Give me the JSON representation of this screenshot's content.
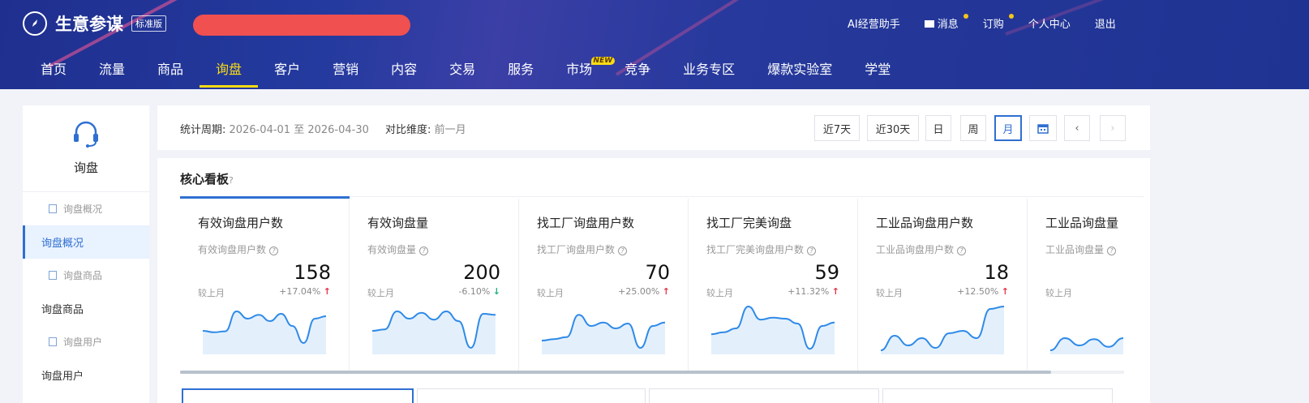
{
  "header": {
    "brand": "生意参谋",
    "edition": "标准版",
    "top_links": [
      "AI经营助手",
      "消息",
      "订购",
      "个人中心",
      "退出"
    ],
    "nav": [
      "首页",
      "流量",
      "商品",
      "询盘",
      "客户",
      "营销",
      "内容",
      "交易",
      "服务",
      "市场",
      "竞争",
      "业务专区",
      "爆款实验室",
      "学堂"
    ],
    "nav_active": "询盘",
    "new_badge": "NEW"
  },
  "sidebar": {
    "title": "询盘",
    "items": [
      {
        "label": "询盘概况",
        "type": "sub"
      },
      {
        "label": "询盘概况",
        "type": "main",
        "active": true
      },
      {
        "label": "询盘商品",
        "type": "sub"
      },
      {
        "label": "询盘商品",
        "type": "main"
      },
      {
        "label": "询盘用户",
        "type": "sub"
      },
      {
        "label": "询盘用户",
        "type": "main"
      }
    ]
  },
  "filter": {
    "period_label": "统计周期:",
    "period_value": "2026-04-01 至 2026-04-30",
    "compare_label": "对比维度:",
    "compare_value": "前一月",
    "buttons": [
      "近7天",
      "近30天",
      "日",
      "周",
      "月"
    ],
    "active_button": "月"
  },
  "board": {
    "title": "核心看板",
    "help": "?",
    "cards": [
      {
        "title": "有效询盘用户数",
        "sub": "有效询盘用户数",
        "value": "158",
        "cmp": "较上月",
        "pct": "+17.04%",
        "dir": "up",
        "spark": [
          0.45,
          0.42,
          0.44,
          0.85,
          0.7,
          0.78,
          0.65,
          0.8,
          0.55,
          0.2,
          0.7,
          0.75
        ]
      },
      {
        "title": "有效询盘量",
        "sub": "有效询盘量",
        "value": "200",
        "cmp": "较上月",
        "pct": "-6.10%",
        "dir": "down",
        "spark": [
          0.45,
          0.48,
          0.85,
          0.7,
          0.82,
          0.68,
          0.85,
          0.65,
          0.1,
          0.8,
          0.78
        ]
      },
      {
        "title": "找工厂询盘用户数",
        "sub": "找工厂询盘用户数",
        "value": "70",
        "cmp": "较上月",
        "pct": "+25.00%",
        "dir": "up",
        "spark": [
          0.25,
          0.28,
          0.32,
          0.78,
          0.55,
          0.62,
          0.5,
          0.6,
          0.1,
          0.55,
          0.62
        ]
      },
      {
        "title": "找工厂完美询盘",
        "sub": "找工厂完美询盘用户数",
        "value": "59",
        "cmp": "较上月",
        "pct": "+11.32%",
        "dir": "up",
        "spark": [
          0.38,
          0.42,
          0.5,
          0.95,
          0.68,
          0.72,
          0.7,
          0.6,
          0.08,
          0.55,
          0.62
        ]
      },
      {
        "title": "工业品询盘用户数",
        "sub": "工业品询盘用户数",
        "value": "18",
        "cmp": "较上月",
        "pct": "+12.50%",
        "dir": "up",
        "spark": [
          0.05,
          0.35,
          0.15,
          0.3,
          0.1,
          0.4,
          0.45,
          0.3,
          0.9,
          0.95
        ]
      },
      {
        "title": "工业品询盘量",
        "sub": "工业品询盘量",
        "value": "",
        "cmp": "较上月",
        "pct": "",
        "dir": "up",
        "spark": [
          0.05,
          0.3,
          0.15,
          0.28,
          0.12,
          0.3
        ]
      }
    ]
  },
  "colors": {
    "accent": "#2f6fd1",
    "nav_active": "#fadb14",
    "up": "#e8334a",
    "down": "#1bb27a",
    "spark_line": "#2f8ae8",
    "spark_fill": "#e3f0fc"
  }
}
